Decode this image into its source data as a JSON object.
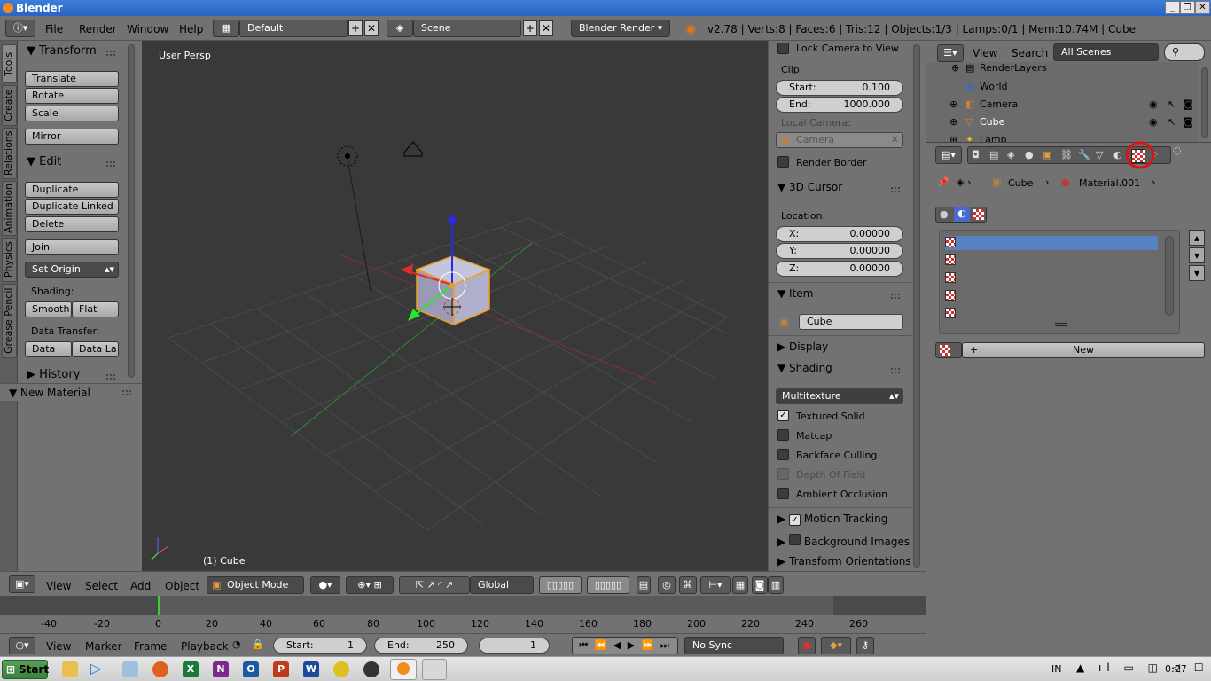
{
  "window": {
    "title": "Blender",
    "controls": [
      "_",
      "❐",
      "✕"
    ]
  },
  "menu": {
    "items": [
      "File",
      "Render",
      "Window",
      "Help"
    ],
    "layout": "Default",
    "scene": "Scene",
    "engine": "Blender Render"
  },
  "stats": "v2.78 | Verts:8 | Faces:6 | Tris:12 | Objects:1/3 | Lamps:0/1 | Mem:10.74M | Cube",
  "vtabs": [
    "Tools",
    "Create",
    "Relations",
    "Animation",
    "Physics",
    "Grease Pencil"
  ],
  "toolshelf": {
    "transform_title": "Transform",
    "translate": "Translate",
    "rotate": "Rotate",
    "scale": "Scale",
    "mirror": "Mirror",
    "edit_title": "Edit",
    "duplicate": "Duplicate",
    "duplicate_linked": "Duplicate Linked",
    "delete": "Delete",
    "join": "Join",
    "set_origin": "Set Origin",
    "shading_label": "Shading:",
    "smooth": "Smooth",
    "flat": "Flat",
    "data_transfer_label": "Data Transfer:",
    "data": "Data",
    "data_la": "Data La",
    "history": "History",
    "new_material": "New Material"
  },
  "viewport": {
    "view_label": "User Persp",
    "object_label": "(1) Cube"
  },
  "npanel": {
    "lock_camera": "Lock Camera to View",
    "clip_label": "Clip:",
    "start_label": "Start:",
    "start_value": "0.100",
    "end_label": "End:",
    "end_value": "1000.000",
    "local_camera_label": "Local Camera:",
    "camera_field": "Camera",
    "render_border": "Render Border",
    "cursor_title": "3D Cursor",
    "location_label": "Location:",
    "x_label": "X:",
    "x_value": "0.00000",
    "y_label": "Y:",
    "y_value": "0.00000",
    "z_label": "Z:",
    "z_value": "0.00000",
    "item_title": "Item",
    "item_name": "Cube",
    "display_title": "Display",
    "shading_title": "Shading",
    "shading_mode": "Multitexture",
    "textured_solid": "Textured Solid",
    "matcap": "Matcap",
    "backface_culling": "Backface Culling",
    "depth_of_field": "Depth Of Field",
    "ambient_occlusion": "Ambient Occlusion",
    "motion_tracking": "Motion Tracking",
    "background_images": "Background Images",
    "transform_orientations": "Transform Orientations"
  },
  "outliner": {
    "view": "View",
    "search": "Search",
    "filter": "All Scenes",
    "rows": [
      "RenderLayers",
      "World",
      "Camera",
      "Cube",
      "Lamp"
    ]
  },
  "properties": {
    "breadcrumb_obj": "Cube",
    "breadcrumb_mat": "Material.001",
    "new_button": "New"
  },
  "vpheader": {
    "view": "View",
    "select": "Select",
    "add": "Add",
    "object": "Object",
    "mode": "Object Mode",
    "orientation": "Global"
  },
  "timeline": {
    "ticks": [
      "-40",
      "-20",
      "0",
      "20",
      "40",
      "60",
      "80",
      "100",
      "120",
      "140",
      "160",
      "180",
      "200",
      "220",
      "240",
      "260"
    ],
    "current_frame": 0
  },
  "tlheader": {
    "view": "View",
    "marker": "Marker",
    "frame": "Frame",
    "playback": "Playback",
    "start_label": "Start:",
    "start_value": "1",
    "end_label": "End:",
    "end_value": "250",
    "current": "1",
    "sync": "No Sync"
  },
  "taskbar": {
    "start": "Start",
    "lang": "IN",
    "time": "0:27"
  }
}
